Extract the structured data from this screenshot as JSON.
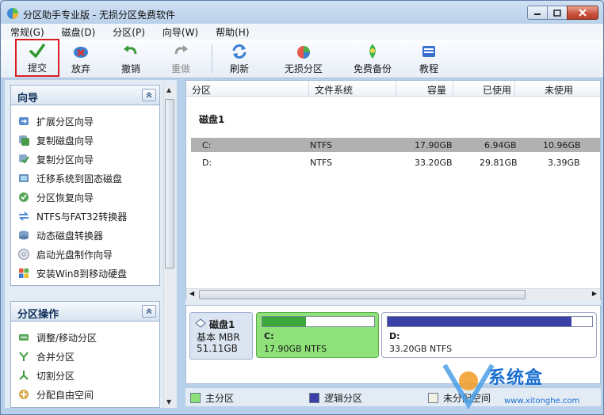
{
  "window": {
    "title": "分区助手专业版 - 无损分区免费软件"
  },
  "menu": [
    {
      "label": "常规(G)"
    },
    {
      "label": "磁盘(D)"
    },
    {
      "label": "分区(P)"
    },
    {
      "label": "向导(W)"
    },
    {
      "label": "帮助(H)"
    }
  ],
  "toolbar": {
    "commit": "提交",
    "discard": "放弃",
    "undo": "撤销",
    "redo": "重做",
    "refresh": "刷新",
    "lossless": "无损分区",
    "backup": "免费备份",
    "tutorial": "教程"
  },
  "wizard_panel": {
    "title": "向导",
    "items": [
      {
        "label": "扩展分区向导"
      },
      {
        "label": "复制磁盘向导"
      },
      {
        "label": "复制分区向导"
      },
      {
        "label": "迁移系统到固态磁盘"
      },
      {
        "label": "分区恢复向导"
      },
      {
        "label": "NTFS与FAT32转换器"
      },
      {
        "label": "动态磁盘转换器"
      },
      {
        "label": "启动光盘制作向导"
      },
      {
        "label": "安装Win8到移动硬盘"
      }
    ]
  },
  "partition_panel": {
    "title": "分区操作",
    "items": [
      {
        "label": "调整/移动分区"
      },
      {
        "label": "合并分区"
      },
      {
        "label": "切割分区"
      },
      {
        "label": "分配自由空间"
      }
    ]
  },
  "table": {
    "headers": [
      "分区",
      "文件系统",
      "容量",
      "已使用",
      "未使用"
    ],
    "disk_label": "磁盘1",
    "rows": [
      {
        "partition": "C:",
        "fs": "NTFS",
        "capacity": "17.90GB",
        "used": "6.94GB",
        "free": "10.96GB"
      },
      {
        "partition": "D:",
        "fs": "NTFS",
        "capacity": "33.20GB",
        "used": "29.81GB",
        "free": "3.39GB"
      }
    ]
  },
  "diskmap": {
    "disk_name": "磁盘1",
    "disk_type": "基本 MBR",
    "disk_size": "51.11GB",
    "c_label": "C:",
    "c_detail": "17.90GB NTFS",
    "c_used_fraction": 0.39,
    "d_label": "D:",
    "d_detail": "33.20GB NTFS",
    "d_used_fraction": 0.9
  },
  "legend": {
    "primary": "主分区",
    "logical": "逻辑分区",
    "unallocated": "未分配空间"
  },
  "watermark": {
    "text": "系统盒",
    "url": "www.xitonghe.com"
  },
  "colors": {
    "primary_partition": "#8fe27a",
    "logical_partition": "#3b3fa8",
    "selection_highlight": "#d81c24"
  }
}
